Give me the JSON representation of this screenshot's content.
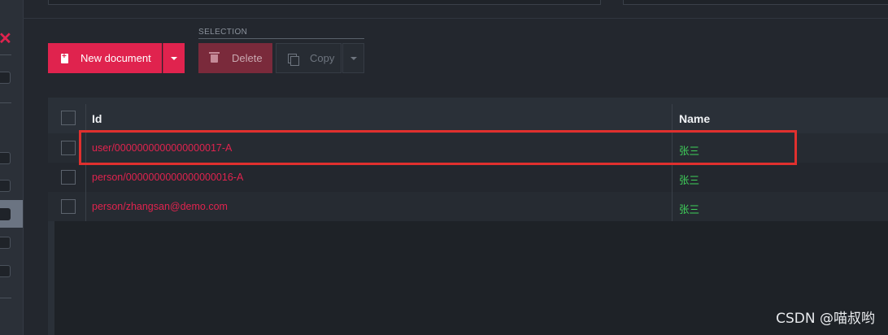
{
  "toolbar": {
    "new_document_label": "New document",
    "selection_label": "SELECTION",
    "delete_label": "Delete",
    "copy_label": "Copy"
  },
  "grid": {
    "columns": [
      "Id",
      "Name"
    ],
    "rows": [
      {
        "id": "user/0000000000000000017-A",
        "name": "张三",
        "highlighted": true
      },
      {
        "id": "person/0000000000000000016-A",
        "name": "张三",
        "highlighted": false
      },
      {
        "id": "person/zhangsan@demo.com",
        "name": "张三",
        "highlighted": false
      }
    ]
  },
  "watermark": "CSDN @喵叔哟",
  "colors": {
    "accent": "#e0234e",
    "name_text": "#3fd15a",
    "background": "#23272e",
    "highlight_box": "#e0302e"
  },
  "icons": [
    "close-icon",
    "new-document-icon",
    "chevron-down-icon",
    "trash-icon",
    "copy-icon"
  ]
}
